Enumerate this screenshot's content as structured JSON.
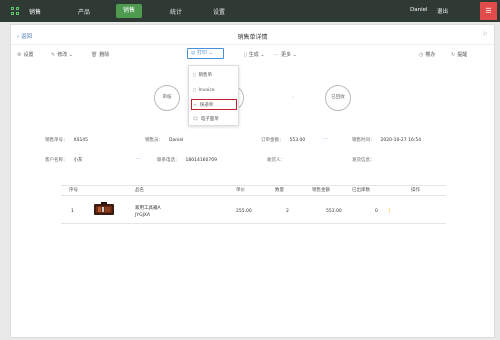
{
  "nav": {
    "app_title": "销售",
    "items": [
      "产品",
      "销售",
      "统计",
      "设置"
    ],
    "user": "Daniel",
    "logout": "退出"
  },
  "page": {
    "back": "返回",
    "title": "销售单详情"
  },
  "toolbar": {
    "settings": "设置",
    "edit": "修改",
    "delete": "删除",
    "print": "打印",
    "generate": "生成",
    "more": "更多",
    "favorite": "樱办",
    "remind": "提醒"
  },
  "dropdown": {
    "items": [
      "销售单",
      "Invoice",
      "快递单",
      "电子面单"
    ]
  },
  "steps": [
    "审核",
    "出库",
    "已回收"
  ],
  "info": {
    "order_no_label": "销售单号：",
    "order_no": "XS145",
    "seller_label": "销售员：",
    "seller": "Daniel",
    "amount_label": "订单金额：",
    "amount": "553.00",
    "time_label": "销售时间：",
    "time": "2020-10-27 16:54",
    "customer_label": "客户名称：",
    "customer": "小灰",
    "phone_label": "联系电话：",
    "phone": "18014160709",
    "receiver_label": "收货人：",
    "receiver": "",
    "address_label": "发货信息：",
    "address": ""
  },
  "table": {
    "headers": [
      "序号",
      "品名",
      "单价",
      "数量",
      "销售金额",
      "已出库数",
      "操作"
    ],
    "rows": [
      {
        "index": "1",
        "name": "家用工具箱A",
        "code": "JYGJXA",
        "price": "255.00",
        "qty": "2",
        "amount": "553.00",
        "shipped": "0"
      }
    ]
  }
}
